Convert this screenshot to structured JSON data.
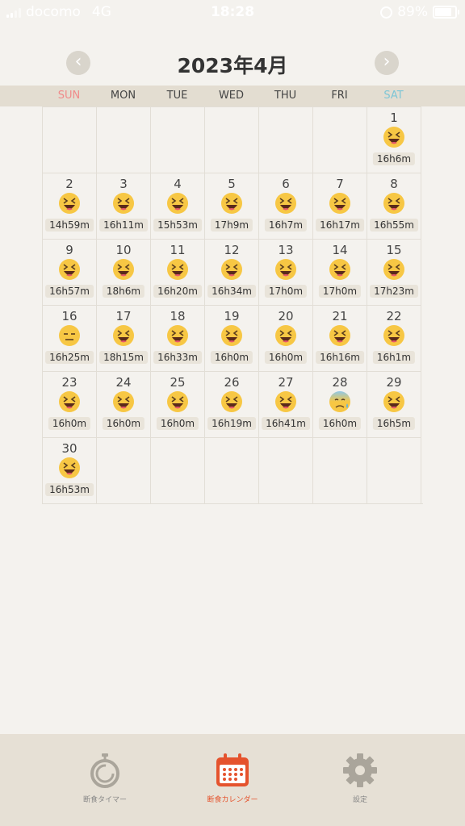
{
  "status_bar": {
    "carrier": "docomo",
    "network": "4G",
    "time": "18:28",
    "battery": "89%",
    "battery_level": 0.89
  },
  "header": {
    "month_title": "2023年4月",
    "prev_icon": "chevron-left-icon",
    "next_icon": "chevron-right-icon"
  },
  "weekdays": [
    "SUN",
    "MON",
    "TUE",
    "WED",
    "THU",
    "FRI",
    "SAT"
  ],
  "calendar": {
    "first_weekday": 6,
    "days": [
      {
        "day": "1",
        "mood": "laugh",
        "duration": "16h6m"
      },
      {
        "day": "2",
        "mood": "laugh",
        "duration": "14h59m"
      },
      {
        "day": "3",
        "mood": "laugh",
        "duration": "16h11m"
      },
      {
        "day": "4",
        "mood": "laugh",
        "duration": "15h53m"
      },
      {
        "day": "5",
        "mood": "laugh",
        "duration": "17h9m"
      },
      {
        "day": "6",
        "mood": "laugh",
        "duration": "16h7m"
      },
      {
        "day": "7",
        "mood": "laugh",
        "duration": "16h17m"
      },
      {
        "day": "8",
        "mood": "laugh",
        "duration": "16h55m"
      },
      {
        "day": "9",
        "mood": "laugh",
        "duration": "16h57m"
      },
      {
        "day": "10",
        "mood": "laugh",
        "duration": "18h6m"
      },
      {
        "day": "11",
        "mood": "laugh",
        "duration": "16h20m"
      },
      {
        "day": "12",
        "mood": "laugh",
        "duration": "16h34m"
      },
      {
        "day": "13",
        "mood": "laugh",
        "duration": "17h0m"
      },
      {
        "day": "14",
        "mood": "laugh",
        "duration": "17h0m"
      },
      {
        "day": "15",
        "mood": "laugh",
        "duration": "17h23m"
      },
      {
        "day": "16",
        "mood": "neutral",
        "duration": "16h25m"
      },
      {
        "day": "17",
        "mood": "laugh",
        "duration": "18h15m"
      },
      {
        "day": "18",
        "mood": "laugh",
        "duration": "16h33m"
      },
      {
        "day": "19",
        "mood": "laugh",
        "duration": "16h0m"
      },
      {
        "day": "20",
        "mood": "laugh",
        "duration": "16h0m"
      },
      {
        "day": "21",
        "mood": "laugh",
        "duration": "16h16m"
      },
      {
        "day": "22",
        "mood": "laugh",
        "duration": "16h1m"
      },
      {
        "day": "23",
        "mood": "laugh",
        "duration": "16h0m"
      },
      {
        "day": "24",
        "mood": "laugh",
        "duration": "16h0m"
      },
      {
        "day": "25",
        "mood": "laugh",
        "duration": "16h0m"
      },
      {
        "day": "26",
        "mood": "laugh",
        "duration": "16h19m"
      },
      {
        "day": "27",
        "mood": "laugh",
        "duration": "16h41m"
      },
      {
        "day": "28",
        "mood": "sweat",
        "duration": "16h0m"
      },
      {
        "day": "29",
        "mood": "laugh",
        "duration": "16h5m"
      },
      {
        "day": "30",
        "mood": "laugh",
        "duration": "16h53m"
      }
    ]
  },
  "tabs": [
    {
      "label": "断食タイマー",
      "icon": "stopwatch-icon",
      "active": false
    },
    {
      "label": "断食カレンダー",
      "icon": "calendar-icon",
      "active": true
    },
    {
      "label": "設定",
      "icon": "gear-icon",
      "active": false
    }
  ],
  "colors": {
    "accent": "#e5532d",
    "sunday": "#f08a8a",
    "saturday": "#7ec6d6",
    "face": "#f7c744"
  }
}
